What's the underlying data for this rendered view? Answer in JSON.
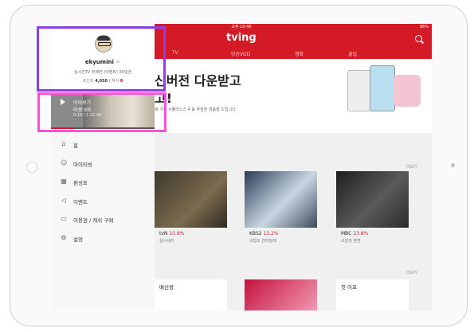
{
  "status_bar": {
    "time": "오후 10:40",
    "device": "iPad",
    "battery": "96%"
  },
  "app": {
    "logo": "tving",
    "tabs": [
      "TV",
      "방송VOD",
      "영화",
      "클립"
    ],
    "banner": {
      "line1": "신버전 다운받고",
      "line2": "고!",
      "sub": "세 가지 시뮬리노스 4 등 푸짐한 경품을 드립니다."
    },
    "more_label": "더보기",
    "cards": [
      {
        "channel": "tvN",
        "rating": "10.8%",
        "title": "삼시세끼"
      },
      {
        "channel": "KBS2",
        "rating": "13.2%",
        "title": "내일도 칸타빌레"
      },
      {
        "channel": "MBC",
        "rating": "23.8%",
        "title": "오만과 편견"
      }
    ],
    "row2": [
      "배신왕",
      "",
      "첫 이프"
    ]
  },
  "drawer": {
    "profile": {
      "username": "ekyumini",
      "chevron": ">",
      "subscription": "실시간TV 무제한 (이벤트) 30일권",
      "points_label": "포인트",
      "points_value": "4,650",
      "cash_label": "캐쉬",
      "cash_value": "0"
    },
    "resume": {
      "label": "이어보기",
      "episode": "미생 0화",
      "time": "0:18 / 1:21:44",
      "progress": 0.22
    },
    "menu": [
      {
        "icon": "home-icon",
        "glyph": "⌂",
        "label": "홈"
      },
      {
        "icon": "person-icon",
        "glyph": "☺",
        "label": "마이티빙"
      },
      {
        "icon": "calendar-icon",
        "glyph": "▦",
        "label": "편성표"
      },
      {
        "icon": "megaphone-icon",
        "glyph": "◁",
        "label": "이벤트"
      },
      {
        "icon": "ticket-icon",
        "glyph": "▭",
        "label": "이용권 / 캐쉬 구매"
      },
      {
        "icon": "gear-icon",
        "glyph": "⚙",
        "label": "설정"
      }
    ]
  },
  "colors": {
    "brand": "#d31a25",
    "highlight_purple": "#8e3cf0",
    "highlight_pink": "#ff4fd8"
  }
}
